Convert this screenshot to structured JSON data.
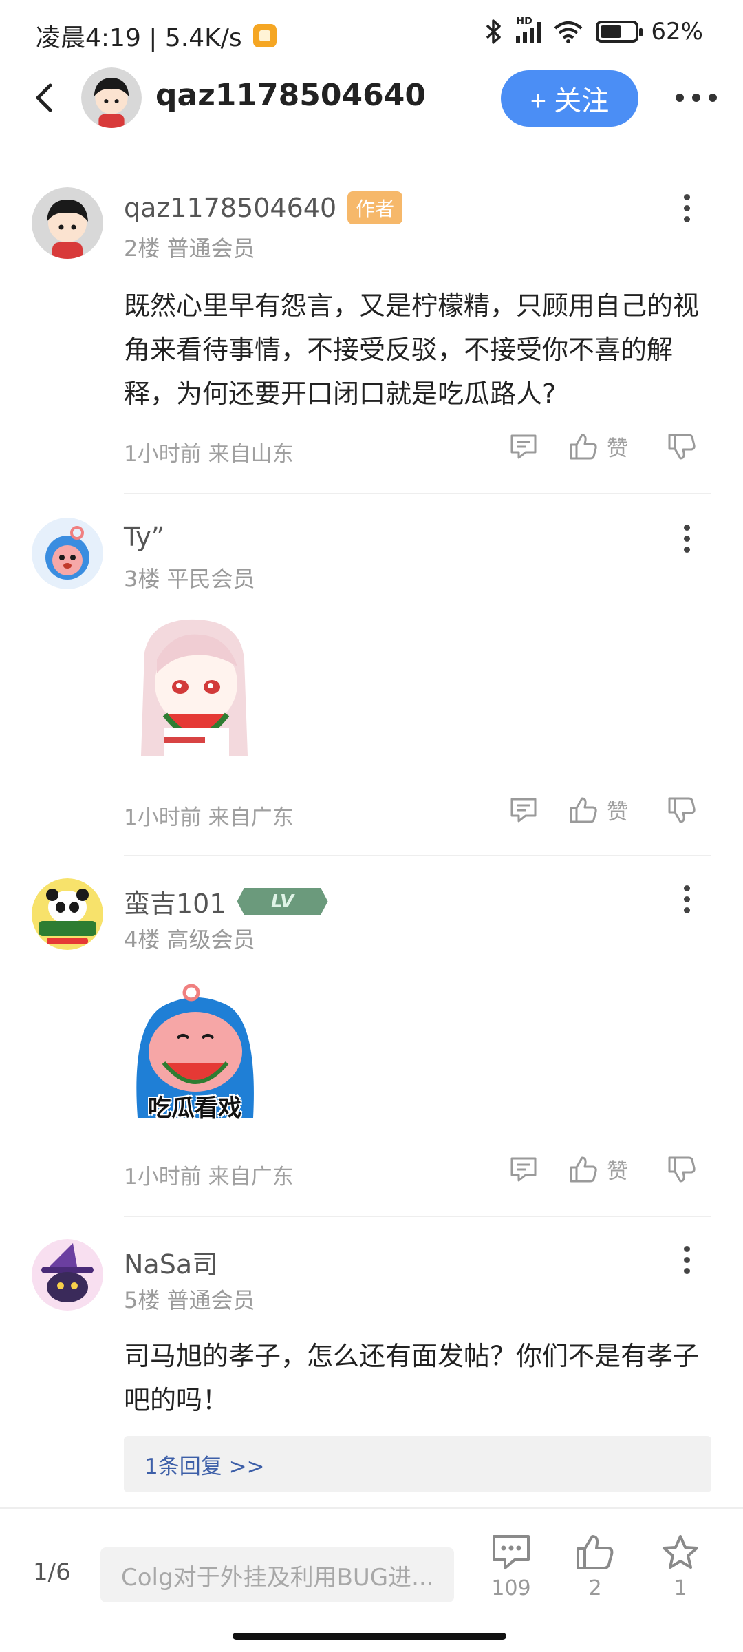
{
  "status_bar": {
    "time_speed": "凌晨4:19 | 5.4K/s",
    "hd_label": "HD",
    "battery": "62%",
    "battery_level": 0.62,
    "icons": [
      "bluetooth-icon",
      "signal-icon",
      "wifi-icon",
      "battery-icon"
    ]
  },
  "header": {
    "username": "qaz1178504640",
    "follow_label": "+ 关注"
  },
  "posts": [
    {
      "username": "qaz1178504640",
      "badge": "作者",
      "floor": "2楼 普通会员",
      "content": "既然心里早有怨言，又是柠檬精，只顾用自己的视角来看待事情，不接受反驳，不接受你不喜的解释，为何还要开口闭口就是吃瓜路人?",
      "meta": "1小时前 来自山东",
      "like_label": "赞"
    },
    {
      "username": "Ty”",
      "floor": "3楼 平民会员",
      "meta": "1小时前 来自广东",
      "like_label": "赞"
    },
    {
      "username": "蛮吉101",
      "level_badge": "LV",
      "floor": "4楼 高级会员",
      "sticker_text": "吃瓜看戏",
      "meta": "1小时前 来自广东",
      "like_label": "赞"
    },
    {
      "username": "NaSa司",
      "floor": "5楼 普通会员",
      "content": "司马旭的孝子，怎么还有面发帖？你们不是有孝子吧的吗！",
      "reply_label": "1条回复 >>"
    }
  ],
  "bottom_bar": {
    "page_indicator": "1/6",
    "input_placeholder": "Colg对于外挂及利用BUG进...",
    "comments_count": "109",
    "likes_count": "2",
    "favorites_count": "1"
  },
  "colors": {
    "accent": "#4b8ef5",
    "author_badge": "#f6b86a",
    "reply_link": "#3d5fa8"
  }
}
